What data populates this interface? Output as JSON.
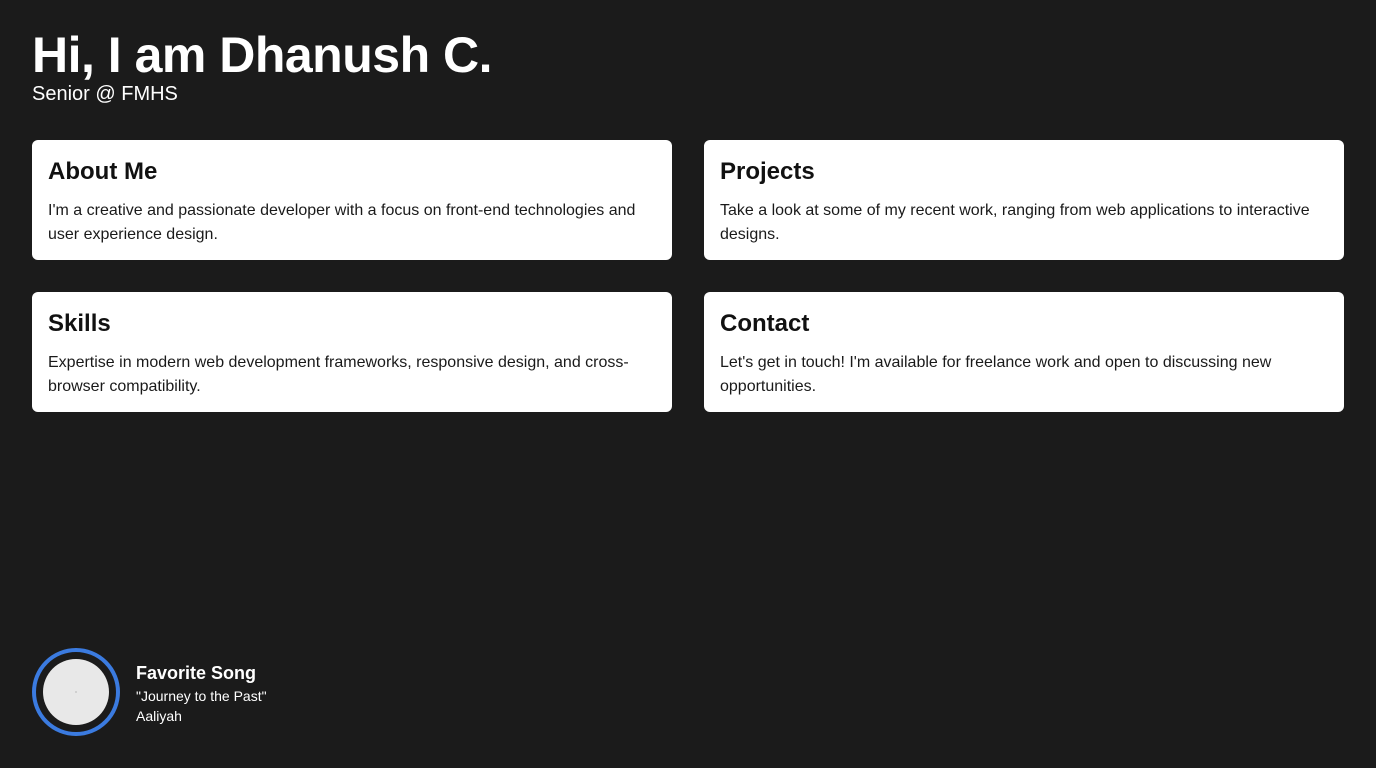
{
  "header": {
    "title": "Hi, I am Dhanush C.",
    "subtitle": "Senior @ FMHS"
  },
  "cards": [
    {
      "title": "About Me",
      "text": "I'm a creative and passionate developer with a focus on front-end technologies and user experience design."
    },
    {
      "title": "Projects",
      "text": "Take a look at some of my recent work, ranging from web applications to interactive designs."
    },
    {
      "title": "Skills",
      "text": "Expertise in modern web development frameworks, responsive design, and cross-browser compatibility."
    },
    {
      "title": "Contact",
      "text": "Let's get in touch! I'm available for freelance work and open to discussing new opportunities."
    }
  ],
  "song": {
    "heading": "Favorite Song",
    "title": "\"Journey to the Past\"",
    "artist": "Aaliyah",
    "icon": "vinyl-disc-icon"
  },
  "colors": {
    "background": "#1b1b1b",
    "card": "#ffffff",
    "accent": "#3b7be0"
  }
}
